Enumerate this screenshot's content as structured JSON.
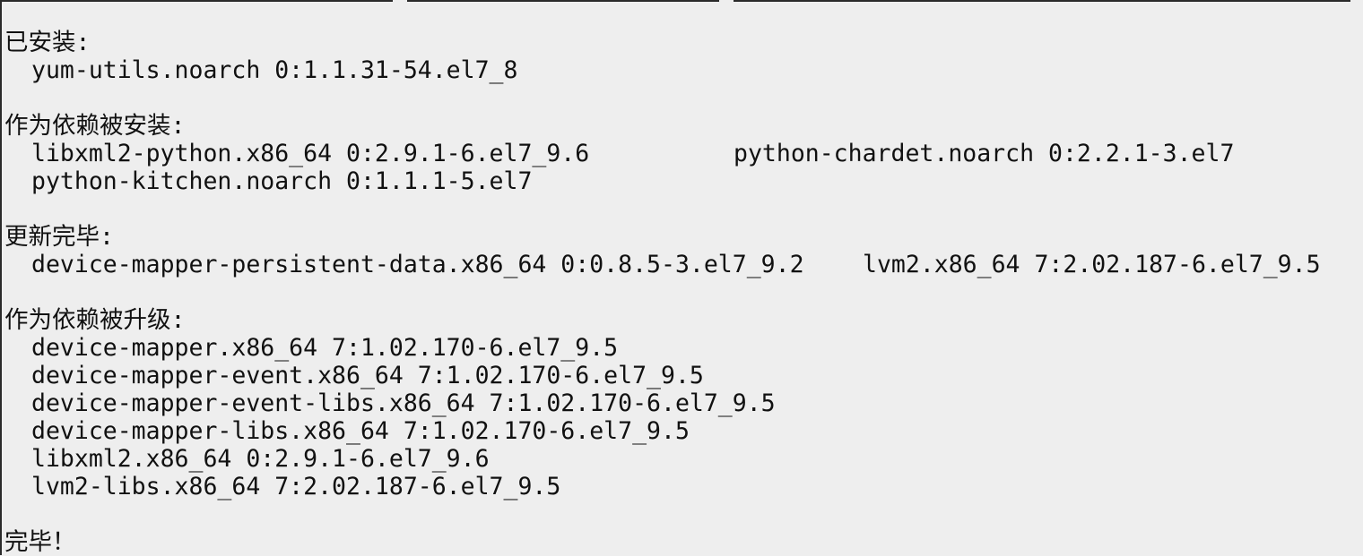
{
  "sections": [
    {
      "heading": "已安装:",
      "entries": [
        "yum-utils.noarch 0:1.1.31-54.el7_8"
      ]
    },
    {
      "heading": "作为依赖被安装:",
      "rows": [
        [
          "libxml2-python.x86_64 0:2.9.1-6.el7_9.6",
          "python-chardet.noarch 0:2.2.1-3.el7"
        ],
        [
          "python-kitchen.noarch 0:1.1.1-5.el7"
        ]
      ]
    },
    {
      "heading": "更新完毕:",
      "rows": [
        [
          "device-mapper-persistent-data.x86_64 0:0.8.5-3.el7_9.2",
          "lvm2.x86_64 7:2.02.187-6.el7_9.5"
        ]
      ]
    },
    {
      "heading": "作为依赖被升级:",
      "entries": [
        "device-mapper.x86_64 7:1.02.170-6.el7_9.5",
        "device-mapper-event.x86_64 7:1.02.170-6.el7_9.5",
        "device-mapper-event-libs.x86_64 7:1.02.170-6.el7_9.5",
        "device-mapper-libs.x86_64 7:1.02.170-6.el7_9.5",
        "libxml2.x86_64 0:2.9.1-6.el7_9.6",
        "lvm2-libs.x86_64 7:2.02.187-6.el7_9.5"
      ]
    }
  ],
  "footer": "完毕！"
}
